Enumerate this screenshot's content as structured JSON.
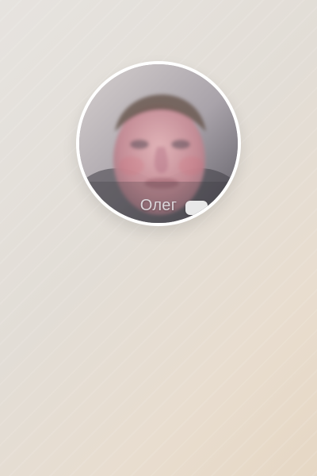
{
  "avatar": {
    "name_label": "Олег",
    "ring_color": "#ffffff"
  },
  "icons": {
    "corner_indicator": "rounded-rectangle-icon"
  }
}
